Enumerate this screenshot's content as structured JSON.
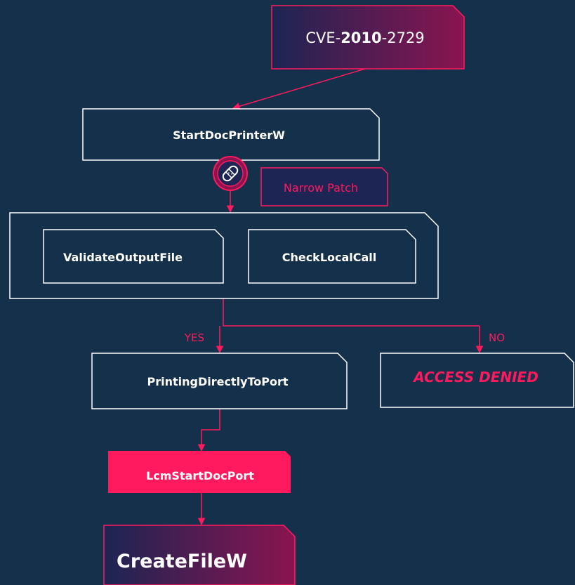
{
  "cve": {
    "prefix": "CVE-",
    "year": "2010",
    "suffix": "-2729"
  },
  "nodes": {
    "start_doc_printer": "StartDocPrinterW",
    "narrow_patch": "Narrow Patch",
    "validate_output_file": "ValidateOutputFile",
    "check_local_call": "CheckLocalCall",
    "printing_directly_to_port": "PrintingDirectlyToPort",
    "access_denied": "ACCESS DENIED",
    "lcm_start_doc_port": "LcmStartDocPort",
    "create_file": "CreateFileW"
  },
  "branches": {
    "yes": "YES",
    "no": "NO"
  },
  "icons": {
    "patch": "bandage-icon"
  },
  "colors": {
    "background": "#14304a",
    "accent": "#ff1a5e",
    "gradient_start": "#1c2553",
    "gradient_end": "#8a1450",
    "text_light": "#ffffff"
  }
}
